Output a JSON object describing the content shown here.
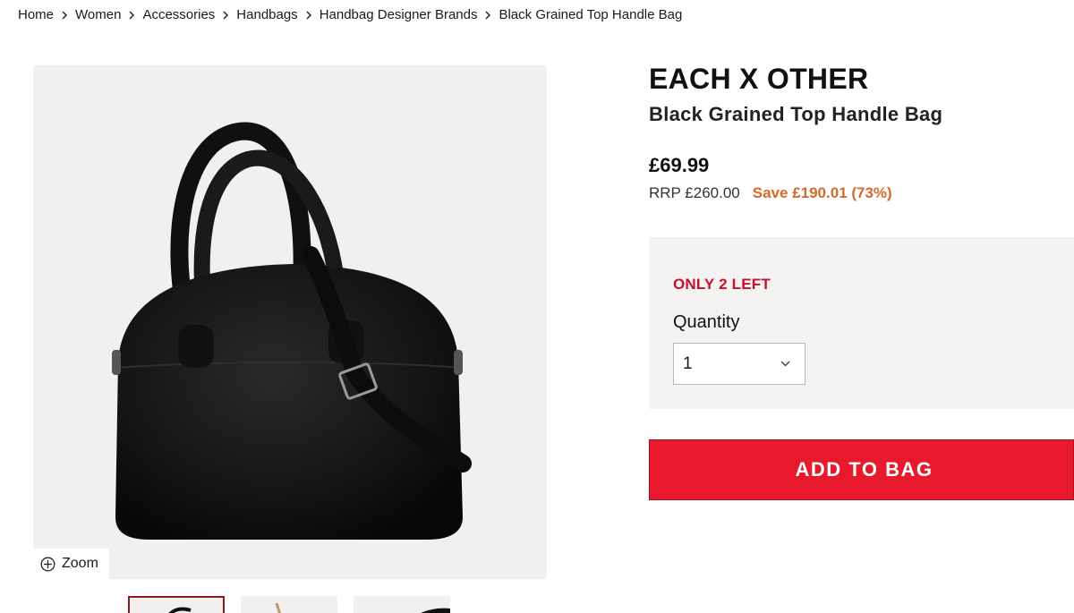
{
  "breadcrumb": {
    "items": [
      "Home",
      "Women",
      "Accessories",
      "Handbags",
      "Handbag Designer Brands",
      "Black Grained Top Handle Bag"
    ]
  },
  "gallery": {
    "zoom_label": "Zoom",
    "thumbnail_count": 3,
    "active_thumbnail": 1
  },
  "product": {
    "brand": "EACH X OTHER",
    "name": "Black Grained Top Handle Bag",
    "price": "£69.99",
    "rrp": "RRP £260.00",
    "saving": "Save £190.01 (73%)"
  },
  "stock": {
    "alert": "ONLY 2 LEFT",
    "quantity_label": "Quantity",
    "quantity_value": "1"
  },
  "actions": {
    "add_to_bag": "ADD TO BAG"
  },
  "colors": {
    "accent_red": "#e8192c",
    "stock_red": "#c8102e",
    "save_orange": "#d4692b",
    "panel_bg": "#f5f3f1"
  },
  "icons": {
    "breadcrumb_separator": "chevron-right-icon",
    "zoom": "zoom-icon",
    "select_arrow": "chevron-down-icon"
  }
}
